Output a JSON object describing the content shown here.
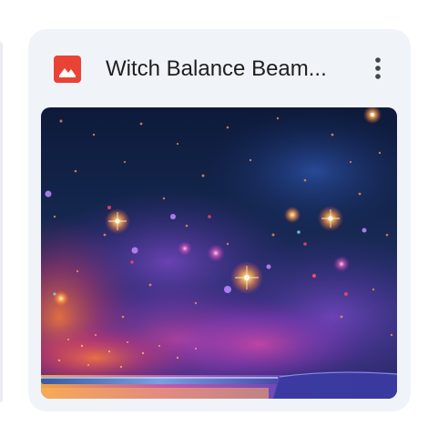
{
  "file_card": {
    "title": "Witch Balance Beam...",
    "file_type_icon": "image-file-icon",
    "menu_icon": "more-vert-icon",
    "thumbnail_icon": "starry-night-image"
  },
  "colors": {
    "card_background": "#f0f4f9",
    "icon_red": "#ea4335",
    "title_text": "#1f1f1f",
    "menu_dots": "#444746"
  }
}
